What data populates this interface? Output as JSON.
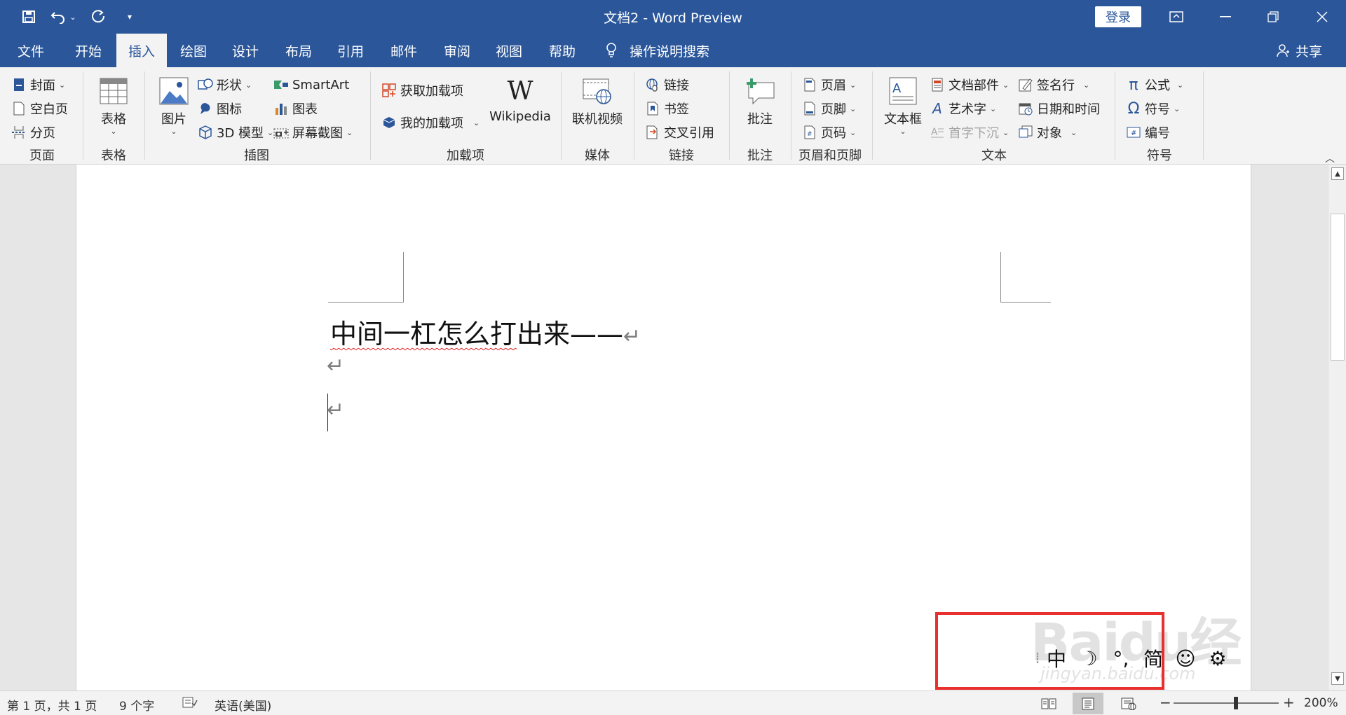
{
  "titlebar": {
    "title": "文档2  -  Word Preview",
    "login": "登录",
    "quick_access": {
      "save_icon": "save-icon",
      "undo_icon": "undo-icon",
      "redo_icon": "redo-icon",
      "customize_icon": "customize-icon"
    }
  },
  "tabs": [
    "文件",
    "开始",
    "插入",
    "绘图",
    "设计",
    "布局",
    "引用",
    "邮件",
    "审阅",
    "视图",
    "帮助"
  ],
  "active_tab": "插入",
  "tell_me": "操作说明搜索",
  "share": "共享",
  "ribbon": {
    "pages": {
      "label": "页面",
      "items": [
        "封面",
        "空白页",
        "分页"
      ]
    },
    "tables": {
      "label": "表格",
      "table": "表格"
    },
    "illustrations": {
      "label": "插图",
      "picture": "图片",
      "shapes": "形状",
      "icons": "图标",
      "model3d": "3D 模型",
      "smartart": "SmartArt",
      "chart": "图表",
      "screenshot": "屏幕截图"
    },
    "addins": {
      "label": "加载项",
      "get": "获取加载项",
      "mine": "我的加载项",
      "wikipedia": "Wikipedia"
    },
    "media": {
      "label": "媒体",
      "video": "联机视频"
    },
    "links": {
      "label": "链接",
      "link": "链接",
      "bookmark": "书签",
      "crossref": "交叉引用"
    },
    "comments": {
      "label": "批注",
      "comment": "批注"
    },
    "header_footer": {
      "label": "页眉和页脚",
      "header": "页眉",
      "footer": "页脚",
      "page_number": "页码"
    },
    "text": {
      "label": "文本",
      "textbox": "文本框",
      "parts": "文档部件",
      "wordart": "艺术字",
      "dropcap": "首字下沉",
      "signature": "签名行",
      "datetime": "日期和时间",
      "object": "对象"
    },
    "symbols": {
      "label": "符号",
      "equation": "公式",
      "symbol": "符号",
      "number": "编号"
    }
  },
  "document": {
    "line1_spell": "中间一杠怎么打",
    "line1_rest": "出来——",
    "para_mark": "↵"
  },
  "ime": {
    "mode": "中",
    "moon": "☽",
    "punct": "°,",
    "simplified": "简",
    "emoji": "☺",
    "settings": "⚙"
  },
  "watermark": {
    "main": "Baidu经验",
    "sub": "jingyan.baidu.com"
  },
  "status": {
    "page": "第 1 页，共 1 页",
    "words": "9 个字",
    "language": "英语(美国)",
    "zoom": "200%",
    "zoom_level_percent": 200
  },
  "colors": {
    "brand": "#2b579a",
    "highlight_box": "#e8302e"
  }
}
